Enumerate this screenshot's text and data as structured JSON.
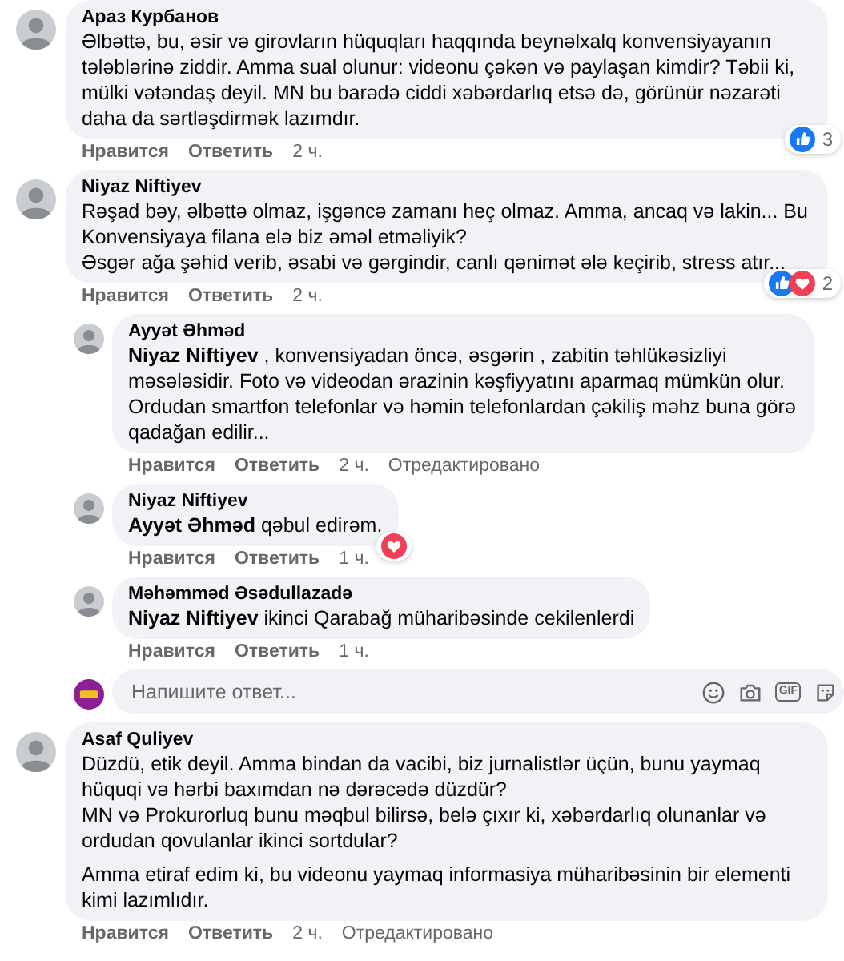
{
  "comments": [
    {
      "author": "Араз Курбанов",
      "paragraphs": [
        "Əlbəttə, bu, əsir və girovların hüquqları haqqında beynəlxalq konvensiyayanın tələblərinə ziddir. Amma sual olunur: videonu çəkən və paylaşan kimdir? Təbii ki, mülki vətəndaş deyil. MN bu barədə ciddi xəbərdarlıq etsə də, görünür nəzarəti daha da sərtləşdirmək lazımdır."
      ],
      "like": "Нравится",
      "reply": "Ответить",
      "time": "2 ч.",
      "reactions": [
        {
          "kind": "like"
        }
      ],
      "reaction_count": "3"
    },
    {
      "author": "Niyaz Niftiyev",
      "paragraphs": [
        "Rəşad bəy, əlbəttə olmaz, işgəncə zamanı heç olmaz. Amma, ancaq və lakin... Bu Konvensiyaya filana elə biz əməl etməliyik?\nƏsgər ağa şəhid verib, əsabi və gərgindir, canlı qənimət ələ keçirib, stress atır..."
      ],
      "like": "Нравится",
      "reply": "Ответить",
      "time": "2 ч.",
      "reactions": [
        {
          "kind": "like"
        },
        {
          "kind": "love"
        }
      ],
      "reaction_count": "2",
      "replies": [
        {
          "author": "Ayyət Əhməd",
          "paragraphs": [
            "**Niyaz Niftiyev** , konvensiyadan öncə, əsgərin , zabitin təhlükəsizliyi məsələsidir. Foto və videodan ərazinin kəşfiyyatını aparmaq mümkün olur. Ordudan smartfon telefonlar və həmin telefonlardan çəkiliş məhz buna görə qadağan edilir..."
          ],
          "like": "Нравится",
          "reply": "Ответить",
          "time": "2 ч.",
          "edited": "Отредактировано"
        },
        {
          "author": "Niyaz Niftiyev",
          "paragraphs": [
            "**Ayyət Əhməd** qəbul edirəm."
          ],
          "like": "Нравится",
          "reply": "Ответить",
          "time": "1 ч.",
          "reactions": [
            {
              "kind": "love"
            }
          ]
        },
        {
          "author": "Məhəmməd Əsədullazadə",
          "paragraphs": [
            "**Niyaz Niftiyev** ikinci Qarabağ müharibəsinde cekilenlerdi"
          ],
          "like": "Нравится",
          "reply": "Ответить",
          "time": "1 ч."
        }
      ],
      "reply_box": {
        "placeholder": "Напишите ответ...",
        "gif_label": "GIF"
      }
    },
    {
      "author": "Asaf Quliyev",
      "paragraphs": [
        "Düzdü, etik deyil. Amma bindan da vacibi, biz jurnalistlər üçün, bunu yaymaq hüquqi və hərbi baxımdan nə dərəcədə düzdür?\nMN və Prokurorluq bunu məqbul bilirsə, belə çıxır ki, xəbərdarlıq olunanlar və ordudan qovulanlar ikinci sortdular?",
        "Amma etiraf edim ki, bu videonu yaymaq informasiya müharibəsinin bir elementi kimi lazımlıdır."
      ],
      "like": "Нравится",
      "reply": "Ответить",
      "time": "2 ч.",
      "edited": "Отредактировано"
    }
  ]
}
